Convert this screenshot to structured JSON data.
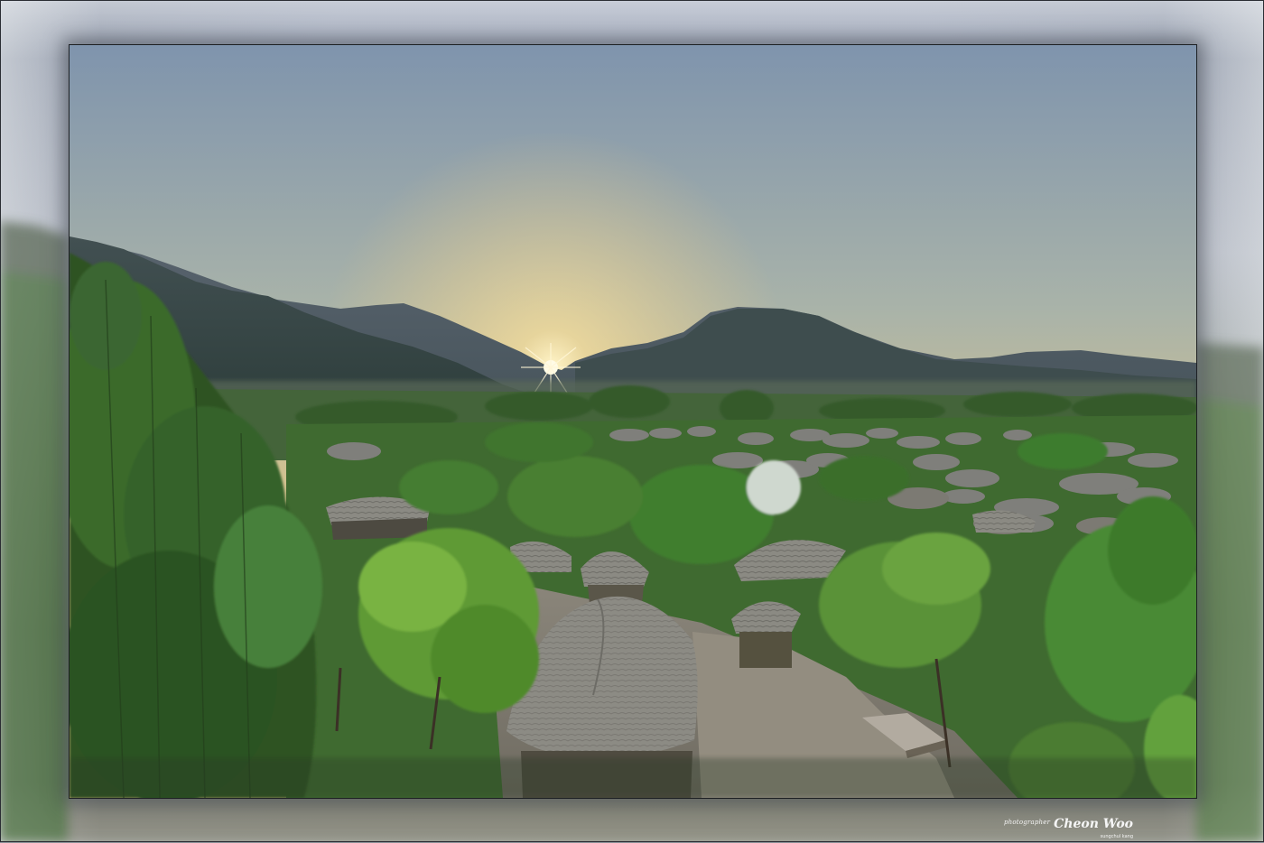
{
  "image": {
    "subject": "sunrise over a thatched-roof village in a mountain valley",
    "palette": {
      "sky_top": "#7f94ad",
      "sky_horizon": "#e9c984",
      "sun": "#fff6d6",
      "mountains_far": "#5d6770",
      "mountains_near": "#3c4a4d",
      "foliage": "#3f7a2f",
      "foliage_light": "#7fb447",
      "thatch": "#8d8c86",
      "ground": "#8a857a"
    }
  },
  "watermark": {
    "prefix": "photographer",
    "name": "Cheon Woo",
    "subtitle": "sungchul kang"
  }
}
